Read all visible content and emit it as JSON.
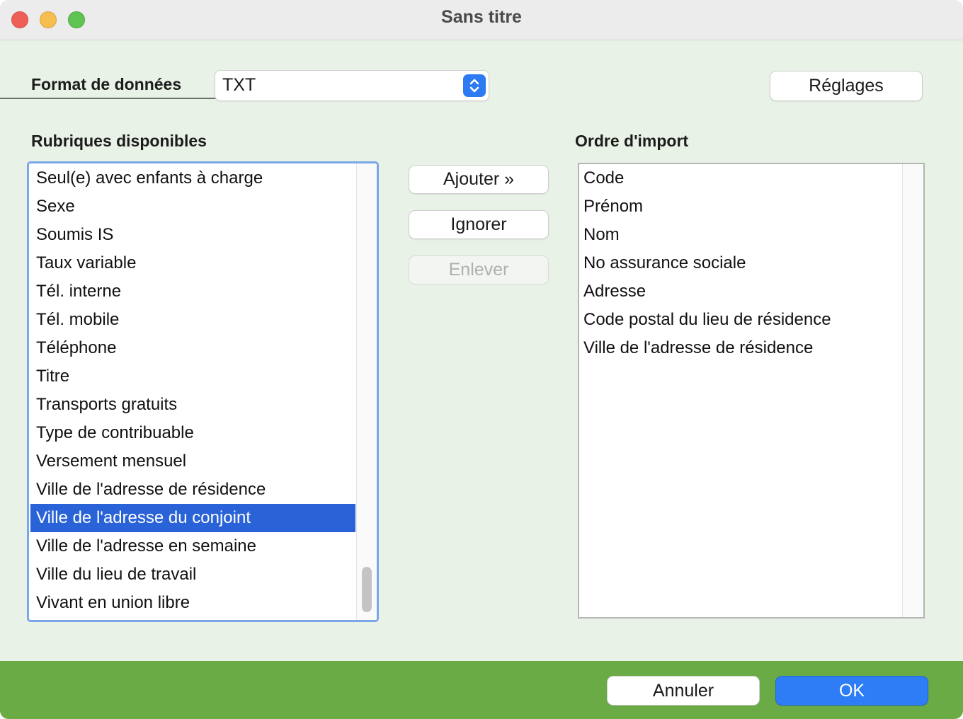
{
  "window": {
    "title": "Sans titre"
  },
  "format": {
    "label": "Format de données",
    "value": "TXT",
    "settings_button": "Réglages"
  },
  "available": {
    "label": "Rubriques disponibles",
    "items": [
      "Seul(e) avec enfants à charge",
      "Sexe",
      "Soumis IS",
      "Taux variable",
      "Tél. interne",
      "Tél. mobile",
      "Téléphone",
      "Titre",
      "Transports gratuits",
      "Type de contribuable",
      "Versement mensuel",
      "Ville de l'adresse de résidence",
      "Ville de l'adresse du conjoint",
      "Ville de l'adresse en semaine",
      "Ville du lieu de travail",
      "Vivant en union libre"
    ],
    "selected_index": 12
  },
  "actions": {
    "add": "Ajouter »",
    "ignore": "Ignorer",
    "remove": "Enlever"
  },
  "import_order": {
    "label": "Ordre d'import",
    "items": [
      "Code",
      "Prénom",
      "Nom",
      "No assurance sociale",
      "Adresse",
      "Code postal du lieu de résidence",
      "Ville de l'adresse de résidence"
    ]
  },
  "footer": {
    "cancel": "Annuler",
    "ok": "OK",
    "accent_color": "#6aab45"
  }
}
